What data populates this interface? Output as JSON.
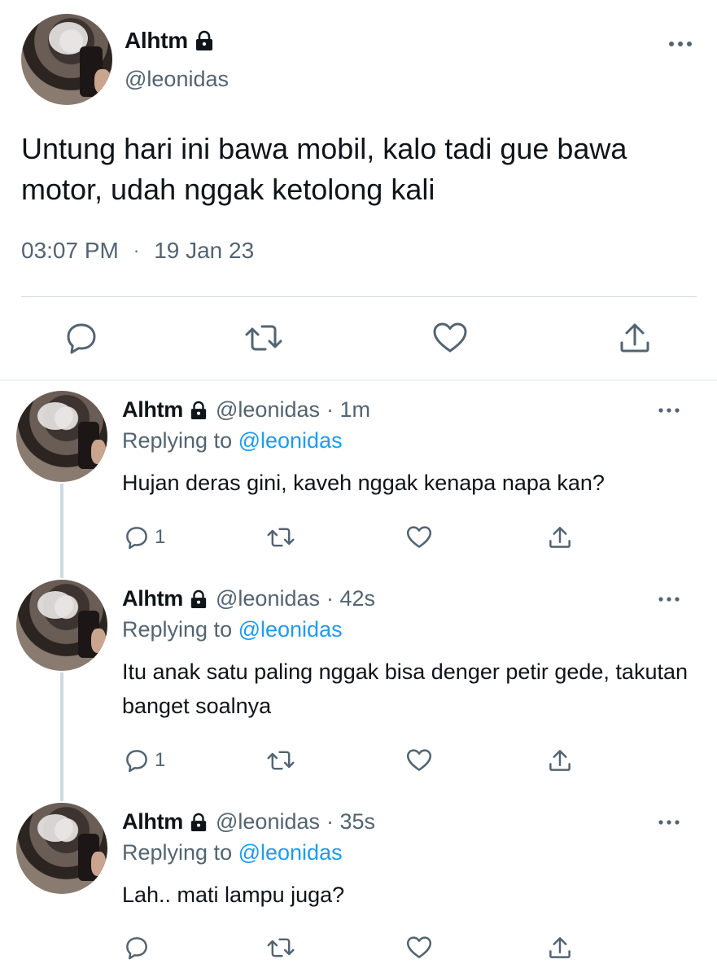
{
  "main_tweet": {
    "name": "Alhtm",
    "handle": "@leonidas",
    "text": "Untung hari ini bawa mobil, kalo tadi gue bawa motor, udah nggak ketolong kali",
    "time": "03:07 PM",
    "separator": "·",
    "date": "19 Jan 23"
  },
  "replies": [
    {
      "name": "Alhtm",
      "handle": "@leonidas",
      "age": "· 1m",
      "replying_prefix": "Replying to ",
      "replying_to": "@leonidas",
      "text": "Hujan deras gini, kaveh nggak kenapa napa kan?",
      "reply_count": "1"
    },
    {
      "name": "Alhtm",
      "handle": "@leonidas",
      "age": "· 42s",
      "replying_prefix": "Replying to ",
      "replying_to": "@leonidas",
      "text": "Itu anak satu paling nggak bisa denger petir gede, takutan banget soalnya",
      "reply_count": "1"
    },
    {
      "name": "Alhtm",
      "handle": "@leonidas",
      "age": "· 35s",
      "replying_prefix": "Replying to ",
      "replying_to": "@leonidas",
      "text": "Lah.. mati lampu juga?",
      "reply_count": ""
    }
  ],
  "icons": [
    "lock-icon",
    "more-icon",
    "reply-icon",
    "retweet-icon",
    "like-icon",
    "share-icon"
  ],
  "colors": {
    "text": "#0f1419",
    "secondary": "#536471",
    "accent": "#1d9bf0",
    "divider": "#cfd9de"
  }
}
